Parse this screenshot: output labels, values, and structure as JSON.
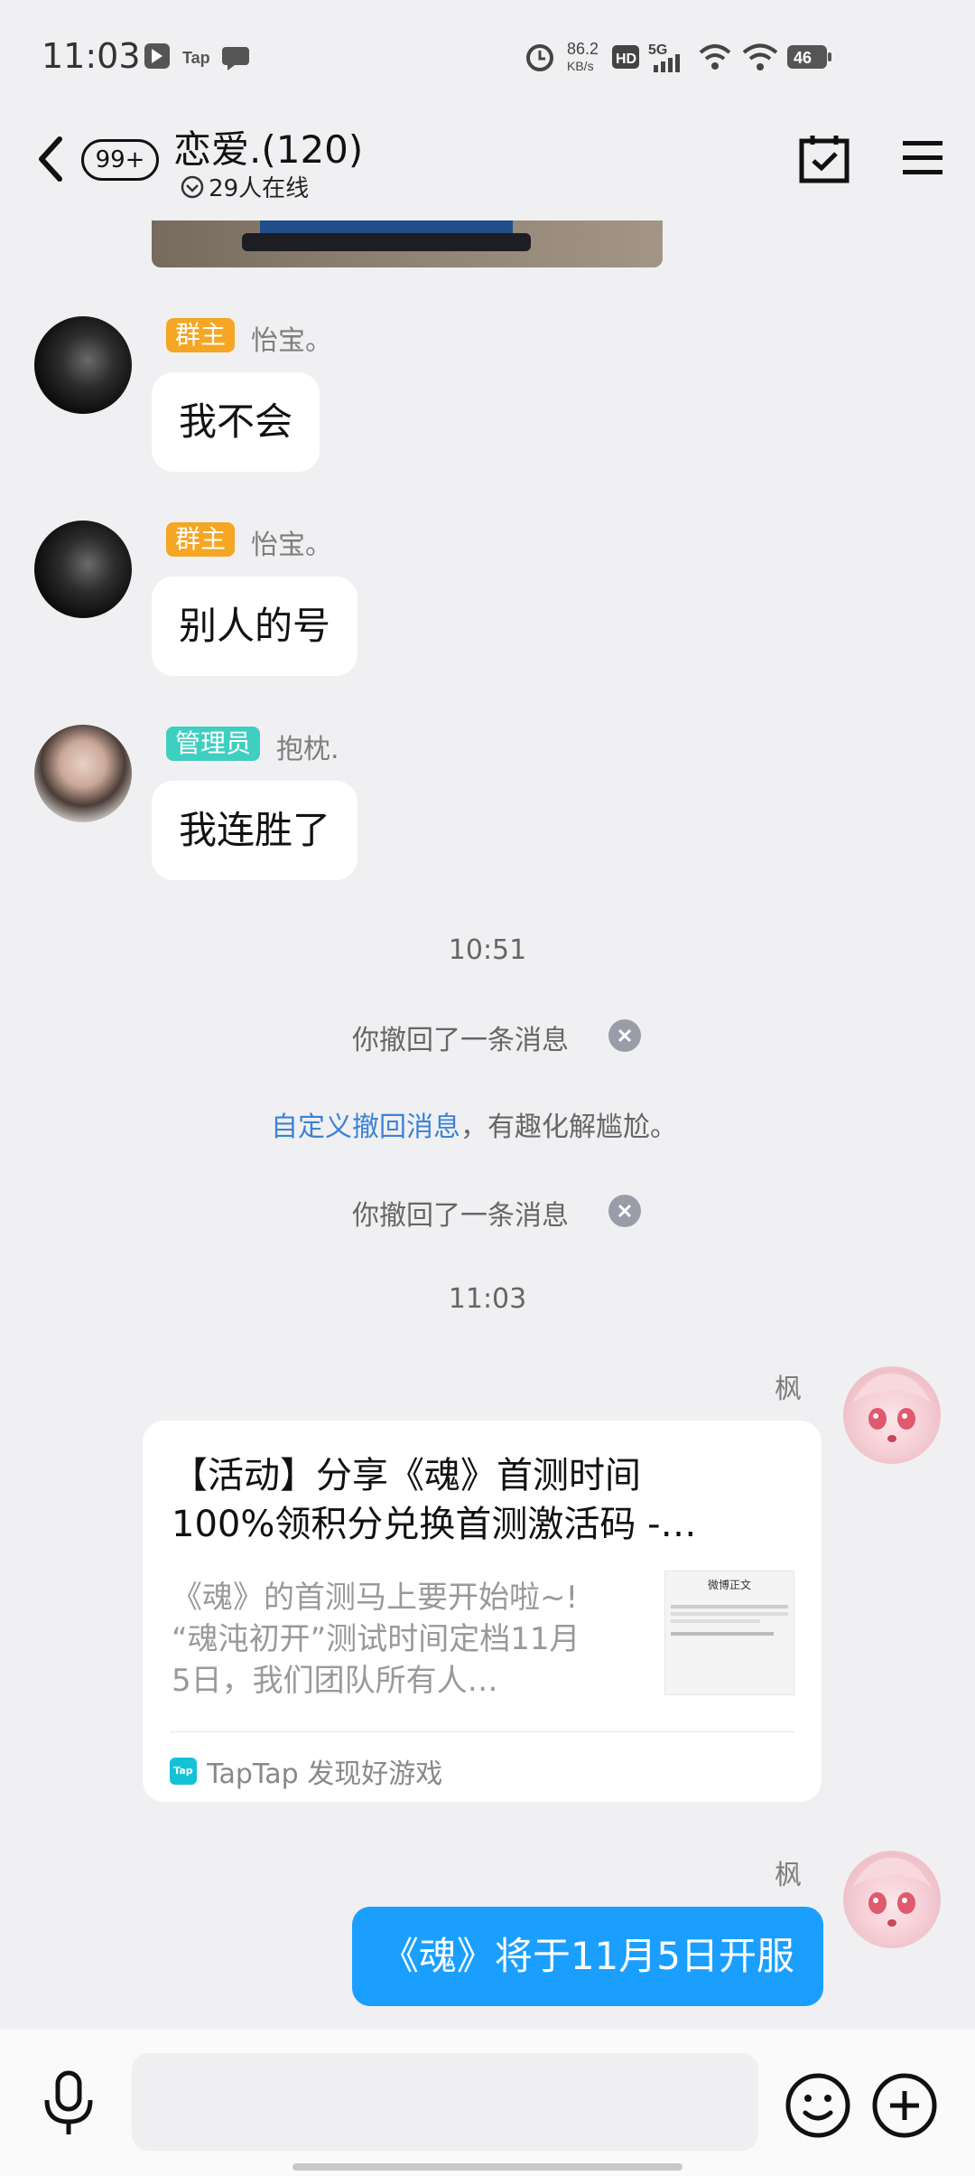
{
  "status_bar": {
    "time": "11:03",
    "speed_value": "86.2",
    "speed_unit": "KB/s",
    "network": "5G",
    "battery": "46",
    "hd_label": "HD",
    "tap_label": "Tap"
  },
  "header": {
    "unread_badge": "99+",
    "title": "恋爱.(120)",
    "subtitle": "29人在线"
  },
  "messages": [
    {
      "role": "群主",
      "name": "怡宝。",
      "text": "我不会"
    },
    {
      "role": "群主",
      "name": "怡宝。",
      "text": "别人的号"
    },
    {
      "role": "管理员",
      "name": "抱枕.",
      "text": "我连胜了"
    }
  ],
  "system": {
    "time1": "10:51",
    "recall1": "你撤回了一条消息",
    "custom_link": "自定义撤回消息",
    "custom_rest": "，有趣化解尴尬。",
    "recall2": "你撤回了一条消息",
    "time2": "11:03"
  },
  "card": {
    "sender": "枫",
    "title_line1": "【活动】分享《魂》首测时间",
    "title_line2": "100%领积分兑换首测激活码 -…",
    "desc_line1": "《魂》的首测马上要开始啦~!",
    "desc_line2": "“魂沌初开”测试时间定档11月",
    "desc_line3": "5日，我们团队所有人…",
    "thumb_heading": "微博正文",
    "source": "TapTap 发现好游戏",
    "source_icon_label": "Tap"
  },
  "last_message": {
    "sender": "枫",
    "text": "《魂》将于11月5日开服"
  },
  "input": {
    "placeholder": ""
  },
  "colors": {
    "owner_badge": "#f5a623",
    "admin_badge": "#3fcfc0",
    "link_blue": "#3b82d6",
    "self_bubble": "#1a9fff"
  }
}
